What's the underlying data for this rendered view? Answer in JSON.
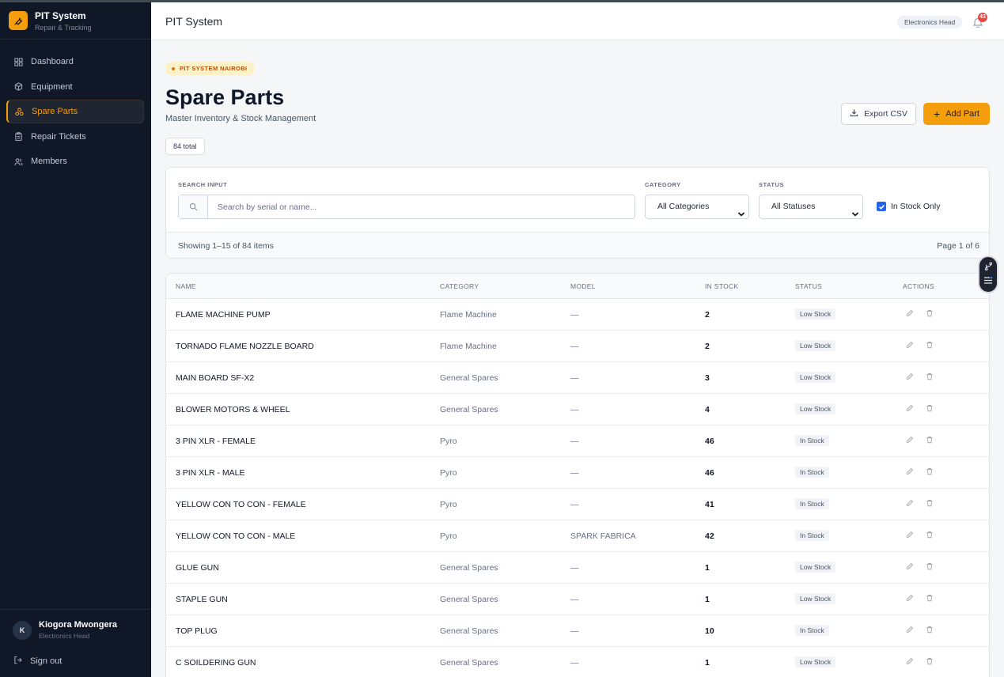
{
  "app": {
    "brand_title": "PIT System",
    "brand_subtitle": "Repair & Tracking",
    "accent": "#f59e0b",
    "sidebar_bg": "#101828"
  },
  "sidebar": {
    "items": [
      {
        "label": "Dashboard",
        "icon": "grid-icon",
        "active": false
      },
      {
        "label": "Equipment",
        "icon": "box-icon",
        "active": false
      },
      {
        "label": "Spare Parts",
        "icon": "parts-icon",
        "active": true
      },
      {
        "label": "Repair Tickets",
        "icon": "clipboard-icon",
        "active": false
      },
      {
        "label": "Members",
        "icon": "users-icon",
        "active": false
      }
    ],
    "user": {
      "initial": "K",
      "name": "Kiogora Mwongera",
      "role": "Electronics Head"
    },
    "signout_label": "Sign out"
  },
  "header": {
    "title": "PIT System",
    "role_chip": "Electronics Head",
    "notification_count": "43"
  },
  "page": {
    "location_chip": "PIT SYSTEM NAIROBI",
    "title": "Spare Parts",
    "subtitle": "Master Inventory & Stock Management",
    "total_chip": "84 total",
    "export_label": "Export CSV",
    "add_label": "Add Part"
  },
  "filters": {
    "search_label": "SEARCH INPUT",
    "search_placeholder": "Search by serial or name...",
    "search_value": "",
    "category_label": "CATEGORY",
    "category_value": "All Categories",
    "status_label": "STATUS",
    "status_value": "All Statuses",
    "in_stock_label": "In Stock Only",
    "in_stock_checked": true,
    "showing_text": "Showing 1–15 of 84 items",
    "page_text": "Page 1 of 6"
  },
  "table": {
    "columns": [
      "NAME",
      "CATEGORY",
      "MODEL",
      "IN STOCK",
      "STATUS",
      "ACTIONS"
    ],
    "rows": [
      {
        "name": "FLAME MACHINE PUMP",
        "category": "Flame Machine",
        "model": "—",
        "stock": "2",
        "status": "Low Stock"
      },
      {
        "name": "TORNADO FLAME NOZZLE BOARD",
        "category": "Flame Machine",
        "model": "—",
        "stock": "2",
        "status": "Low Stock"
      },
      {
        "name": "MAIN BOARD SF-X2",
        "category": "General Spares",
        "model": "—",
        "stock": "3",
        "status": "Low Stock"
      },
      {
        "name": "BLOWER MOTORS & WHEEL",
        "category": "General Spares",
        "model": "—",
        "stock": "4",
        "status": "Low Stock"
      },
      {
        "name": "3 PIN XLR - FEMALE",
        "category": "Pyro",
        "model": "—",
        "stock": "46",
        "status": "In Stock"
      },
      {
        "name": "3 PIN XLR - MALE",
        "category": "Pyro",
        "model": "—",
        "stock": "46",
        "status": "In Stock"
      },
      {
        "name": "YELLOW CON TO CON - FEMALE",
        "category": "Pyro",
        "model": "—",
        "stock": "41",
        "status": "In Stock"
      },
      {
        "name": "YELLOW CON TO CON - MALE",
        "category": "Pyro",
        "model": "SPARK FABRICA",
        "stock": "42",
        "status": "In Stock"
      },
      {
        "name": "GLUE GUN",
        "category": "General Spares",
        "model": "—",
        "stock": "1",
        "status": "Low Stock"
      },
      {
        "name": "STAPLE GUN",
        "category": "General Spares",
        "model": "—",
        "stock": "1",
        "status": "Low Stock"
      },
      {
        "name": "TOP PLUG",
        "category": "General Spares",
        "model": "—",
        "stock": "10",
        "status": "In Stock"
      },
      {
        "name": "C SOILDERING GUN",
        "category": "General Spares",
        "model": "—",
        "stock": "1",
        "status": "Low Stock"
      }
    ]
  }
}
